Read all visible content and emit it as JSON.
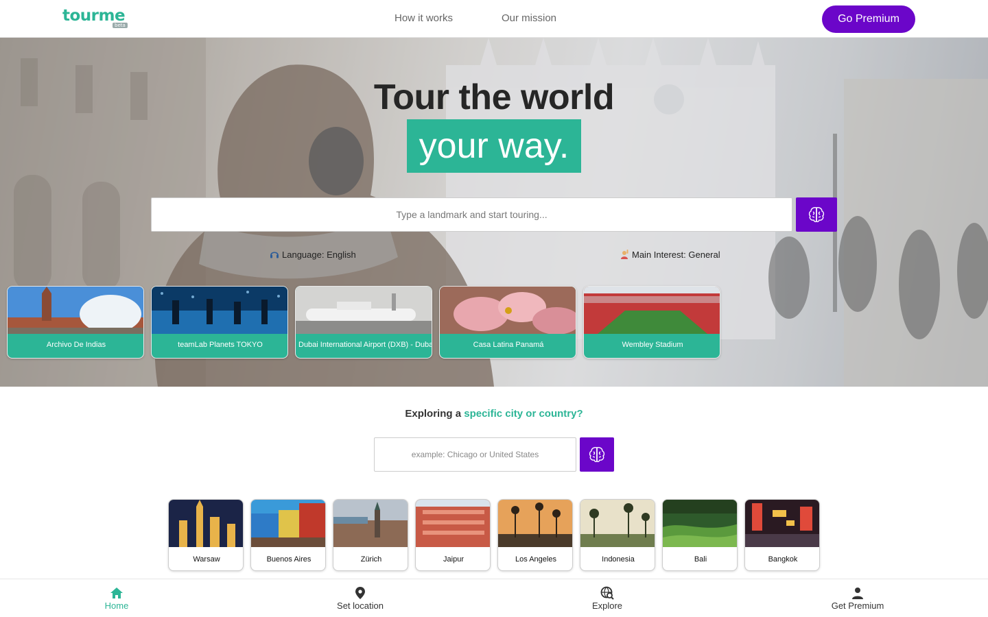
{
  "header": {
    "logo": "tourme",
    "logo_badge": "beta",
    "nav": [
      {
        "label": "How it works"
      },
      {
        "label": "Our mission"
      }
    ],
    "premium_label": "Go Premium"
  },
  "hero": {
    "title": "Tour the world",
    "highlight": "your way.",
    "search_placeholder": "Type a landmark and start touring...",
    "language_label": "Language: English",
    "interest_label": "Main Interest: General",
    "landmarks": [
      {
        "name": "Archivo De Indias"
      },
      {
        "name": "teamLab Planets TOKYO"
      },
      {
        "name": "Dubai International Airport (DXB) - Dubai"
      },
      {
        "name": "Casa Latina Panamá"
      },
      {
        "name": "Wembley Stadium"
      }
    ]
  },
  "explore": {
    "title_prefix": "Exploring a",
    "title_accent": "specific city or country?",
    "input_placeholder": "example: Chicago or United States",
    "cities": [
      {
        "name": "Warsaw"
      },
      {
        "name": "Buenos Aires"
      },
      {
        "name": "Zürich"
      },
      {
        "name": "Jaipur"
      },
      {
        "name": "Los Angeles"
      },
      {
        "name": "Indonesia"
      },
      {
        "name": "Bali"
      },
      {
        "name": "Bangkok"
      }
    ]
  },
  "bottom_nav": [
    {
      "label": "Home",
      "active": true
    },
    {
      "label": "Set location"
    },
    {
      "label": "Explore"
    },
    {
      "label": "Get Premium"
    }
  ],
  "colors": {
    "brand": "#2cb596",
    "premium": "#6b06c9"
  }
}
